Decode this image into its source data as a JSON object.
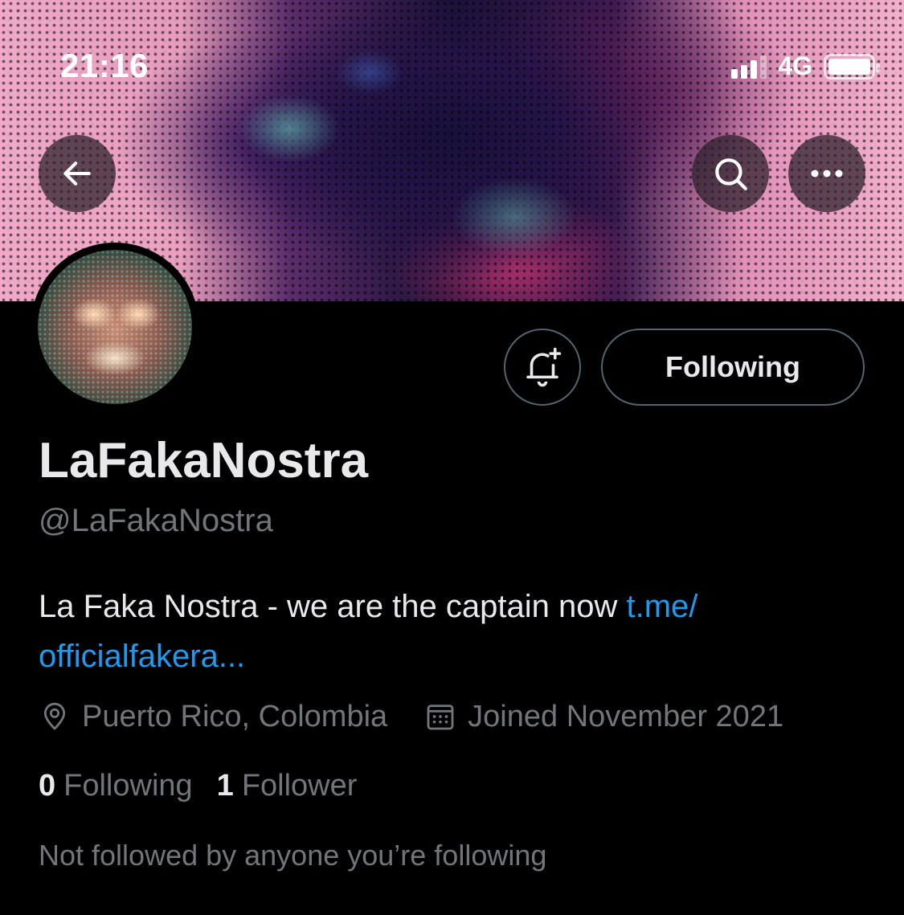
{
  "status_bar": {
    "time": "21:16",
    "network": "4G"
  },
  "header": {
    "back_icon": "arrow-left-icon",
    "search_icon": "search-icon",
    "more_icon": "more-horizontal-icon"
  },
  "profile": {
    "display_name": "LaFakaNostra",
    "handle": "@LaFakaNostra",
    "bio_text": "La Faka Nostra - we are the captain now ",
    "bio_link_line1": "t.me/",
    "bio_link_line2": "officialfakera...",
    "location": "Puerto Rico, Colombia",
    "joined": "Joined November 2021",
    "following_count": "0",
    "following_label": "Following",
    "followers_count": "1",
    "followers_label": "Follower",
    "mutuals_note": "Not followed by anyone you’re following"
  },
  "actions": {
    "notify_icon": "bell-plus-icon",
    "follow_state_label": "Following"
  },
  "colors": {
    "background": "#000000",
    "primary_text": "#e7e9ea",
    "secondary_text": "#71767b",
    "link": "#1d9bf0",
    "button_border": "#536471"
  }
}
